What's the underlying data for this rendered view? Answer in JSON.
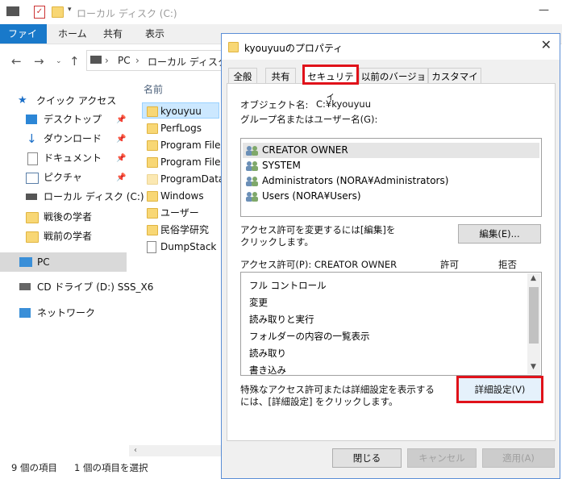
{
  "explorer": {
    "title": "ローカル ディスク (C:)",
    "ribbon_tabs": [
      "ファイル",
      "ホーム",
      "共有",
      "表示"
    ],
    "address": [
      "PC",
      "ローカル ディスク (C:"
    ],
    "nav": {
      "quick_access": "クイック アクセス",
      "desktop": "デスクトップ",
      "downloads": "ダウンロード",
      "documents": "ドキュメント",
      "pictures": "ピクチャ",
      "local_disk": "ローカル ディスク (C:)",
      "folder1": "戦後の学者",
      "folder2": "戦前の学者",
      "pc": "PC",
      "cd_drive": "CD ドライブ (D:) SSS_X6",
      "network": "ネットワーク"
    },
    "column_name": "名前",
    "files": [
      "kyouyuu",
      "PerfLogs",
      "Program Files",
      "Program Files",
      "ProgramData",
      "Windows",
      "ユーザー",
      "民俗学研究",
      "DumpStack"
    ],
    "status_items": "9 個の項目",
    "status_selected": "1 個の項目を選択"
  },
  "dialog": {
    "title": "kyouyuuのプロパティ",
    "tabs": [
      "全般",
      "共有",
      "セキュリティ",
      "以前のバージョン",
      "カスタマイズ"
    ],
    "object_label": "オブジェクト名:",
    "object_value": "C:¥kyouyuu",
    "groups_label": "グループ名またはユーザー名(G):",
    "groups": [
      "CREATOR OWNER",
      "SYSTEM",
      "Administrators (NORA¥Administrators)",
      "Users (NORA¥Users)"
    ],
    "edit_hint_1": "アクセス許可を変更するには[編集]を",
    "edit_hint_2": "クリックします。",
    "edit_button": "編集(E)...",
    "perm_label": "アクセス許可(P): CREATOR OWNER",
    "allow": "許可",
    "deny": "拒否",
    "permissions": [
      "フル コントロール",
      "変更",
      "読み取りと実行",
      "フォルダーの内容の一覧表示",
      "読み取り",
      "書き込み"
    ],
    "advanced_hint_1": "特殊なアクセス許可または詳細設定を表示する",
    "advanced_hint_2": "には、[詳細設定] をクリックします。",
    "advanced_button": "詳細設定(V)",
    "ok_button": "閉じる",
    "cancel_button": "キャンセル",
    "apply_button": "適用(A)"
  }
}
